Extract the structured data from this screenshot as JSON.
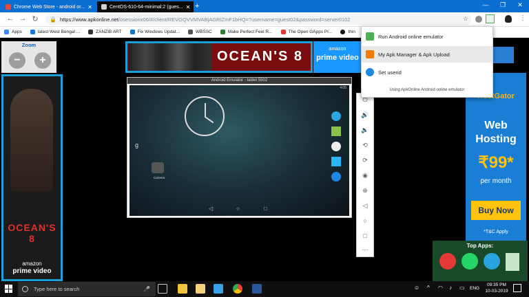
{
  "tabs": [
    {
      "title": "Chrome Web Store - android or...",
      "active": false
    },
    {
      "title": "CentOS-610-64-minimal:2 (gues...",
      "active": true
    }
  ],
  "new_tab": "+",
  "window_controls": {
    "minimize": "—",
    "maximize": "❐",
    "close": "✕"
  },
  "toolbar": {
    "back": "←",
    "forward": "→",
    "reload": "↻"
  },
  "omnibox": {
    "host": "https://www.apkonline.net",
    "path": "/osessionx06/#/client/REVGQVVMVABjAGRIZmF1bHQ=?username=guest02&password=server0102"
  },
  "bookmarks": [
    {
      "label": "Apps",
      "color": "#4285f4"
    },
    {
      "label": "latest West Bengal ...",
      "color": "#1a73e8"
    },
    {
      "label": "ZANZIB ART",
      "color": "#333333"
    },
    {
      "label": "Fix Windows Updat...",
      "color": "#0078d7"
    },
    {
      "label": "WBSSC",
      "color": "#555555"
    },
    {
      "label": "Make Perfect Feel R...",
      "color": "#2e7d32"
    },
    {
      "label": "The Open GApps Pr...",
      "color": "#e53935"
    },
    {
      "label": "thin",
      "color": "#111111"
    }
  ],
  "zoom": {
    "title": "Zoom",
    "minus": "−",
    "plus": "+"
  },
  "ads": {
    "movie_title": "OCEAN'S 8",
    "amazon": "amazon",
    "prime": "prime video",
    "hostgator": "HostGator",
    "web_hosting_1": "Web",
    "web_hosting_2": "Hosting",
    "price": "₹99*",
    "per_month": "per month",
    "buy_now": "Buy Now",
    "tc": "*T&C Apply"
  },
  "emulator": {
    "title": "Android Emulator - tablet 5502",
    "time": "4:05",
    "camera_label": "Camera"
  },
  "dropdown": {
    "items": [
      {
        "label": "Run Android online emulator",
        "color": "#4caf50"
      },
      {
        "label": "My Apk Manager & Apk Upload",
        "color": "#f57c00"
      },
      {
        "label": "Set userid",
        "color": "#1e88e5"
      }
    ],
    "footer": "Using ApkOnline Android online emulator"
  },
  "top_apps": {
    "title": "Top Apps:"
  },
  "taskbar": {
    "search_placeholder": "Type here to search",
    "lang": "ENG",
    "time": "09:35 PM",
    "date": "10-03-2019"
  },
  "colors": {
    "chrome_blue": "#0a6fd1",
    "accent": "#1a9fd9",
    "buy_now": "#ffc20e"
  }
}
